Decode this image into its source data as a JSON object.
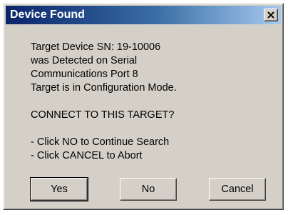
{
  "window": {
    "title": "Device Found"
  },
  "icons": {
    "close": "close-icon"
  },
  "message": {
    "lines": [
      "Target Device SN: 19-10006",
      "was Detected on Serial",
      "Communications Port 8",
      "Target is in Configuration Mode.",
      "",
      "CONNECT TO THIS TARGET?",
      "",
      "- Click NO to Continue Search",
      "- Click CANCEL to Abort"
    ]
  },
  "buttons": {
    "yes_label": "Yes",
    "no_label": "No",
    "cancel_label": "Cancel"
  },
  "colors": {
    "title_start": "#0a246a",
    "title_end": "#a6caf0",
    "dialog_face": "#d4d0c8"
  }
}
